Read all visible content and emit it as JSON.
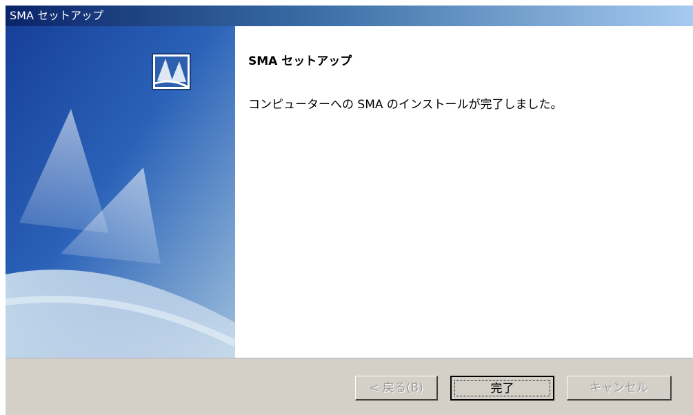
{
  "window": {
    "title": "SMA セットアップ"
  },
  "main": {
    "heading": "SMA セットアップ",
    "message": "コンピューターへの SMA のインストールが完了しました。"
  },
  "buttons": {
    "back": {
      "label": "< 戻る(B)",
      "enabled": false
    },
    "finish": {
      "label": "完了",
      "enabled": true,
      "default": true
    },
    "cancel": {
      "label": "キャンセル",
      "enabled": false
    }
  },
  "icons": {
    "setup": "setup-icon"
  },
  "colors": {
    "titlebar_start": "#0a246a",
    "titlebar_end": "#a6caf0",
    "dialog_face": "#d4d0c8",
    "banner_blue": "#1f4ea8"
  }
}
